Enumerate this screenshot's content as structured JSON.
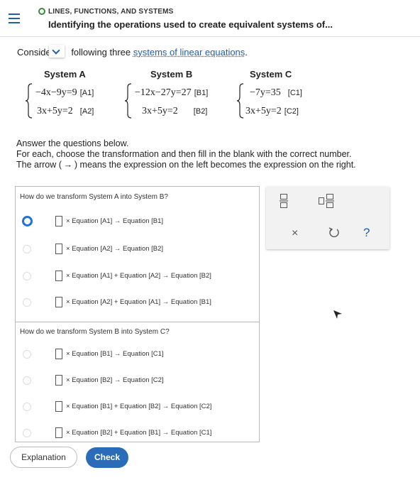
{
  "header": {
    "topic": "LINES, FUNCTIONS, AND SYSTEMS",
    "title": "Identifying the operations used to create equivalent systems of..."
  },
  "prompt": {
    "before": "Conside",
    "after": " following three ",
    "link": "systems of linear equations",
    "end": "."
  },
  "systems": [
    {
      "name": "System A",
      "eq1": "−4x−9y=9",
      "tag1": "[A1]",
      "eq2": "3x+5y=2",
      "tag2": "[A2]"
    },
    {
      "name": "System B",
      "eq1": "−12x−27y=27",
      "tag1": "[B1]",
      "eq2": "3x+5y=2",
      "tag2": "[B2]"
    },
    {
      "name": "System C",
      "eq1": "−7y=35",
      "tag1": "[C1]",
      "eq2": "3x+5y=2",
      "tag2": "[C2]"
    }
  ],
  "instructions": {
    "line1": "Answer the questions below.",
    "line2": "For each, choose the transformation and then fill in the blank with the correct number.",
    "line3a": "The arrow (",
    "arrow": "→",
    "line3b": ") means the expression on the left becomes the expression on the right."
  },
  "questions": [
    {
      "title": "How do we transform System A into System B?",
      "options": [
        "× Equation [A1] → Equation [B1]",
        "× Equation [A2] → Equation [B2]",
        "× Equation [A1] + Equation [A2] → Equation [B2]",
        "× Equation [A2] + Equation [A1] → Equation [B1]"
      ],
      "selected_index": 0
    },
    {
      "title": "How do we transform System B into System C?",
      "options": [
        "× Equation [B1] → Equation [C1]",
        "× Equation [B2] → Equation [C2]",
        "× Equation [B1] + Equation [B2] → Equation [C2]",
        "× Equation [B2] + Equation [B1] → Equation [C1]"
      ],
      "selected_index": null
    }
  ],
  "tools": {
    "fraction_icon": "fraction-icon",
    "mixed_number_icon": "mixed-number-icon",
    "clear_label": "×",
    "undo_icon": "undo-icon",
    "help_label": "?"
  },
  "buttons": {
    "explanation": "Explanation",
    "check": "Check"
  },
  "colors": {
    "accent": "#1f5fae",
    "check_button": "#2b6cb8",
    "radio_selected": "#1f75d6",
    "topic_dot": "#3a8a3a"
  }
}
